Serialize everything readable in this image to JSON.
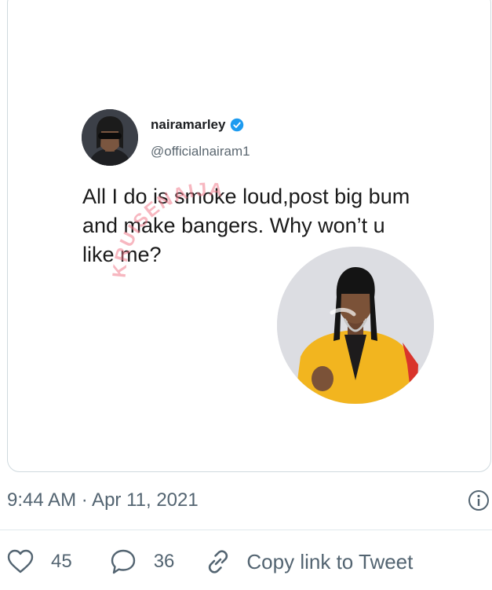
{
  "tweet_card": {
    "author_name": "nairamarley",
    "author_handle": "@officialnairam1",
    "text": "All I do is smoke loud,post big bum and make bangers. Why won’t u like me?",
    "watermark": "KRUISENAIJA"
  },
  "meta": {
    "timestamp": "9:44 AM · Apr 11, 2021"
  },
  "actions": {
    "like_count": "45",
    "reply_count": "36",
    "copy_link_label": "Copy link to Tweet"
  },
  "colors": {
    "verified_blue": "#1d9bf0",
    "muted_text": "#536471",
    "jacket_yellow": "#f2b51f",
    "watermark_pink": "#f07b8c"
  }
}
